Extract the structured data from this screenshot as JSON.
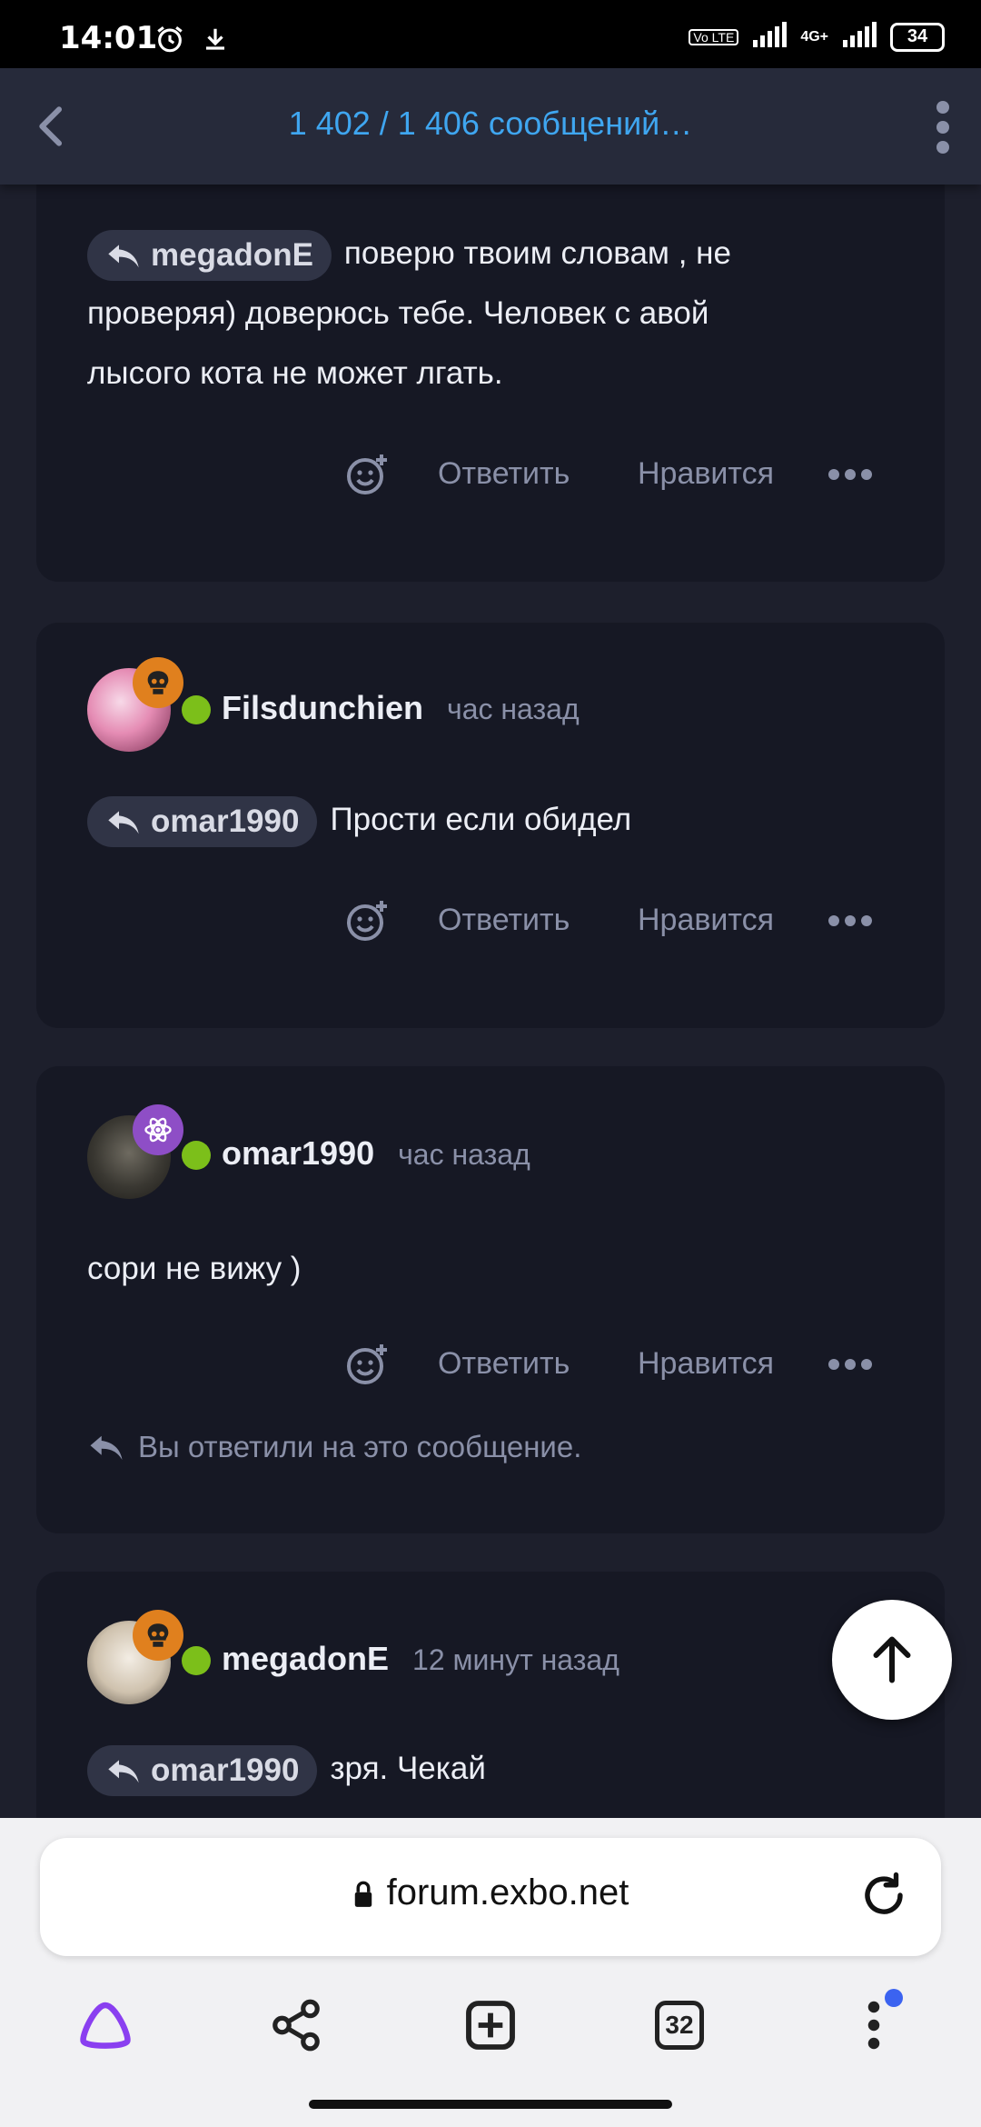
{
  "status_bar": {
    "time": "14:01",
    "battery": "34",
    "network_1": "Vo LTE",
    "network_2": "4G+"
  },
  "header": {
    "title": "1 402 / 1 406 сообщений…"
  },
  "posts": [
    {
      "mention": "megadonE",
      "text_lines": [
        "поверю твоим словам , не",
        "проверяя) доверюсь тебе. Человек с авой",
        "лысого кота не может лгать."
      ],
      "reply_label": "Ответить",
      "like_label": "Нравится"
    },
    {
      "author": "Filsdunchien",
      "time": "час назад",
      "mention": "omar1990",
      "text": "Прости если обидел",
      "reply_label": "Ответить",
      "like_label": "Нравится"
    },
    {
      "author": "omar1990",
      "time": "час назад",
      "text": "сори не вижу )",
      "reply_label": "Ответить",
      "like_label": "Нравится",
      "replied_note": "Вы ответили на это сообщение."
    },
    {
      "author": "megadonE",
      "time": "12 минут назад",
      "mention": "omar1990",
      "text": "зря. Чекай"
    }
  ],
  "browser": {
    "url": "forum.exbo.net",
    "tabs_count": "32"
  },
  "colors": {
    "accent": "#3fa6f0",
    "online": "#7cbf1a",
    "badge_skull": "#e0801e",
    "badge_atom": "#8e4ec6",
    "card_bg": "#161824",
    "page_bg": "#1d1f2c"
  }
}
